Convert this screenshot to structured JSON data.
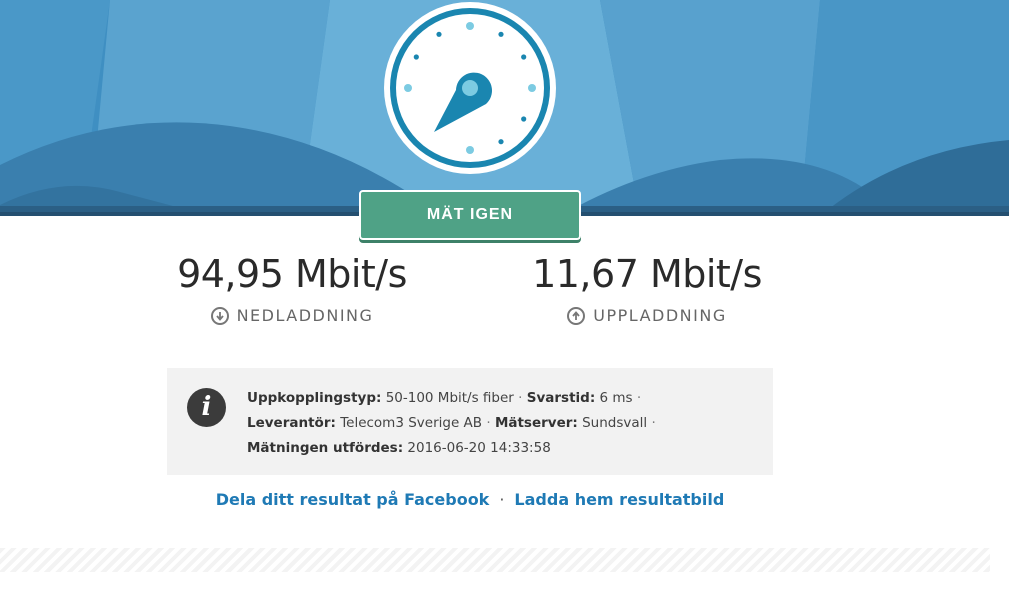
{
  "colors": {
    "hero_bg": "#3f8fc2",
    "gauge_accent": "#1a86b0",
    "retest_button": "#4fa286",
    "link": "#1f7ab5",
    "info_bg": "#f2f2f2"
  },
  "hero": {
    "gauge_icon": "speedometer-icon",
    "retest_label": "MÄT IGEN"
  },
  "results": {
    "download": {
      "value": "94,95 Mbit/s",
      "label": "NEDLADDNING",
      "icon": "download-arrow-icon"
    },
    "upload": {
      "value": "11,67 Mbit/s",
      "label": "UPPLADDNING",
      "icon": "upload-arrow-icon"
    }
  },
  "info": {
    "icon": "info-icon",
    "icon_glyph": "i",
    "connection_type_label": "Uppkopplingstyp:",
    "connection_type_value": "50-100 Mbit/s fiber",
    "latency_label": "Svarstid:",
    "latency_value": "6 ms",
    "provider_label": "Leverantör:",
    "provider_value": "Telecom3 Sverige AB",
    "server_label": "Mätserver:",
    "server_value": "Sundsvall",
    "date_label": "Mätningen utfördes:",
    "date_value": "2016-06-20 14:33:58",
    "separator": "·"
  },
  "links": {
    "facebook": "Dela ditt resultat på Facebook",
    "separator": "·",
    "download_image": "Ladda hem resultatbild"
  }
}
